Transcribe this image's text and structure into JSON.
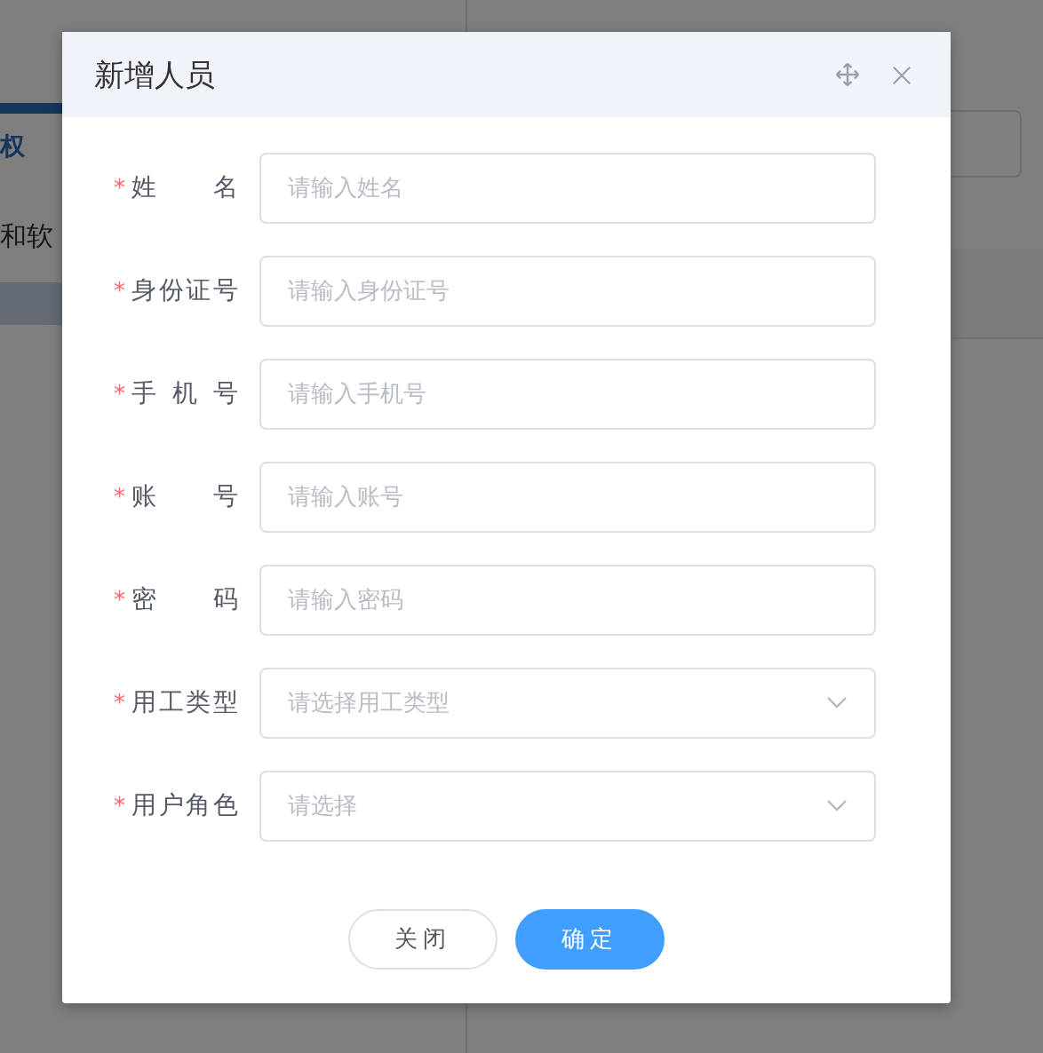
{
  "background": {
    "tab_label": "权",
    "row_text": "和软"
  },
  "dialog": {
    "title": "新增人员",
    "required_mark": "*",
    "fields": [
      {
        "label": "姓名",
        "required": true,
        "kind": "input",
        "placeholder": "请输入姓名"
      },
      {
        "label": "身份证号",
        "required": true,
        "kind": "input",
        "placeholder": "请输入身份证号"
      },
      {
        "label": "手机号",
        "required": true,
        "kind": "input",
        "placeholder": "请输入手机号"
      },
      {
        "label": "账号",
        "required": true,
        "kind": "input",
        "placeholder": "请输入账号"
      },
      {
        "label": "密码",
        "required": true,
        "kind": "input",
        "placeholder": "请输入密码"
      },
      {
        "label": "用工类型",
        "required": true,
        "kind": "select",
        "placeholder": "请选择用工类型"
      },
      {
        "label": "用户角色",
        "required": true,
        "kind": "select",
        "placeholder": "请选择"
      }
    ],
    "buttons": [
      {
        "label": "关闭",
        "kind": "secondary"
      },
      {
        "label": "确定",
        "kind": "primary"
      }
    ]
  }
}
